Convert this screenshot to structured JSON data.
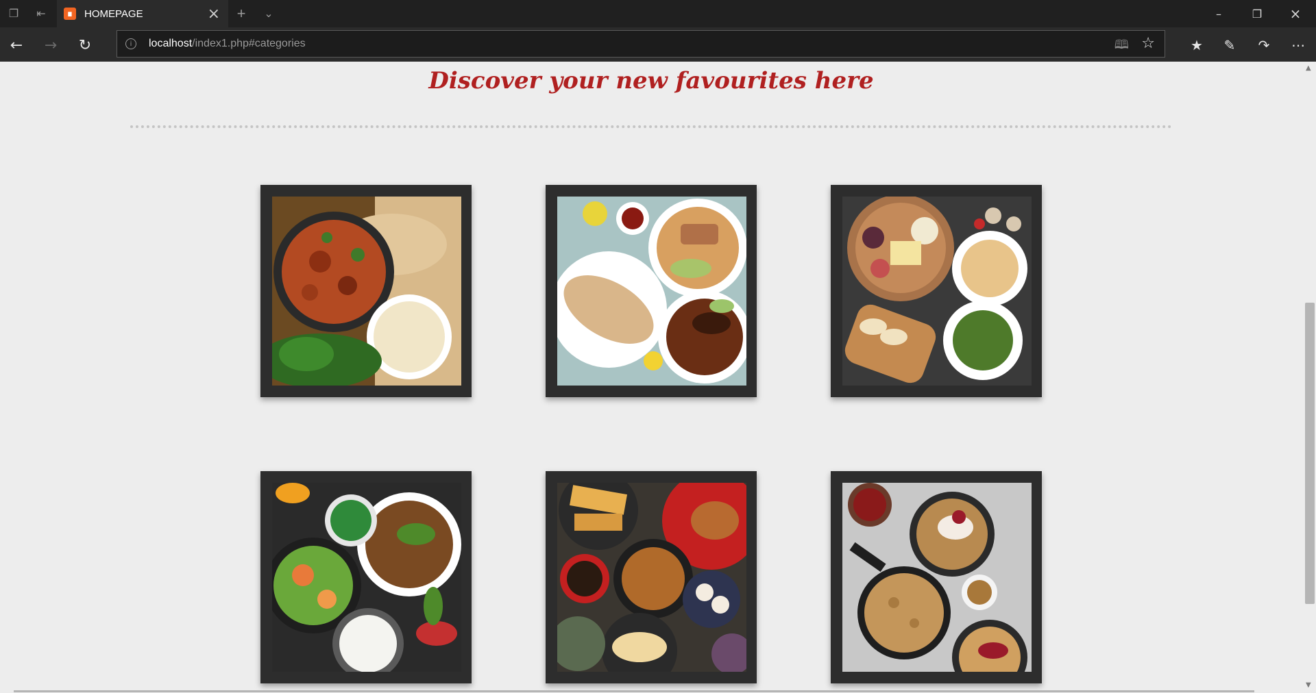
{
  "browser": {
    "tab": {
      "title": "HOMEPAGE",
      "favicon": "xampp-icon"
    },
    "address": {
      "host": "localhost",
      "path": "/index1.php#categories"
    }
  },
  "page": {
    "heading": "Discover your new favourites here",
    "heading_color": "#b02020",
    "categories": [
      {
        "image": "indian-curry-dishes"
      },
      {
        "image": "asian-noodle-wrap-dishes"
      },
      {
        "image": "italian-cheese-pasta-board"
      },
      {
        "image": "chinese-stir-fry-dishes"
      },
      {
        "image": "dim-sum-platter"
      },
      {
        "image": "skillet-desserts"
      }
    ]
  }
}
